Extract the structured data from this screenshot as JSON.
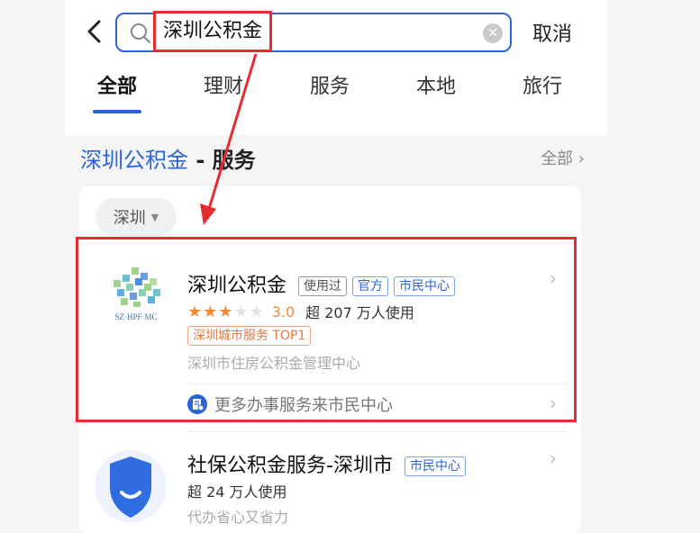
{
  "search": {
    "value": "深圳公积金",
    "cancel_label": "取消"
  },
  "tabs": [
    {
      "label": "全部",
      "active": true
    },
    {
      "label": "理财"
    },
    {
      "label": "服务"
    },
    {
      "label": "本地"
    },
    {
      "label": "旅行"
    }
  ],
  "section": {
    "title_keyword": "深圳公积金",
    "title_suffix": " - 服务",
    "more_label": "全部"
  },
  "filter": {
    "city": "深圳"
  },
  "services": [
    {
      "name": "深圳公积金",
      "tags": [
        "使用过",
        "官方",
        "市民中心"
      ],
      "rating": 3.0,
      "rating_text": "3.0",
      "usage": "超 207 万人使用",
      "badge": "深圳城市服务 TOP1",
      "description": "深圳市住房公积金管理中心",
      "more_link": "更多办事服务来市民中心",
      "logo_text": "SZ·HPF·MC"
    },
    {
      "name": "社保公积金服务-深圳市",
      "tags": [
        "市民中心"
      ],
      "usage": "超 24 万人使用",
      "description": "代办省心又省力"
    }
  ],
  "colors": {
    "accent": "#2b64d9",
    "annotation": "#e62c2c",
    "star": "#f08a3c"
  }
}
